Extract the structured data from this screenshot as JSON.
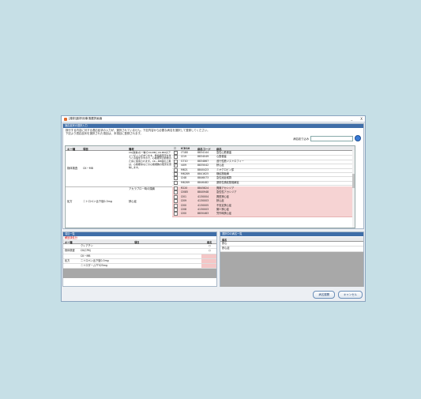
{
  "window": {
    "title": "[薬剤]副作用事項選択画面",
    "minimize": "_",
    "close": "X"
  },
  "top_section": {
    "label": "適応症状の選択入力",
    "message_line1": "検行する内容に対する適応症状の入力が、選択されていません。下記内容から必要な病名を選択して登録してください。",
    "message_line2": "下記より適応症状を選択された項目は、本項目に登録されます。",
    "search_label": "病名絞り込み",
    "search_value": ""
  },
  "grid": {
    "headers": {
      "key": "キー種",
      "item": "項目",
      "note": "備考",
      "check": "☑",
      "icd": "ICD10",
      "code": "病名コード",
      "name": "病名"
    },
    "group1": {
      "key": "検体検査",
      "item": "CK－MB",
      "note": "CK(酵素)の一種でCK-MBとCK-MMのアイソザイムがあります。骨格筋障害を伴うと高値を示すので、心筋障害の診断のために使用されます。CK－MB値の上昇は、心筋梗塞などの心筋細胞の障害を意味します。",
      "rows": [
        {
          "checked": false,
          "icd": "I7180",
          "code": "8834144",
          "name": "急性心筋梗塞",
          "pink": false
        },
        {
          "checked": false,
          "icd": "I219",
          "code": "8834049",
          "name": "心筋梗塞",
          "pink": false
        },
        {
          "checked": false,
          "icd": "G710",
          "code": "8834867",
          "name": "進行性筋ジストロフィー",
          "pink": false
        },
        {
          "checked": true,
          "icd": "I409",
          "code": "8835042",
          "name": "狭心症",
          "pink": false
        },
        {
          "checked": false,
          "icd": "M621",
          "code": "8840423",
          "name": "ミオグロビン尿",
          "pink": false
        },
        {
          "checked": false,
          "icd": "M6289",
          "code": "8841625",
          "name": "横紋筋融解",
          "pink": false
        },
        {
          "checked": false,
          "icd": "I248",
          "code": "8846073",
          "name": "急性冠症候群",
          "pink": false
        },
        {
          "checked": false,
          "icd": "M6289",
          "code": "8846482",
          "name": "薬剤性横紋筋融解症",
          "pink": false
        }
      ]
    },
    "group2": {
      "key": "処方",
      "item": "ニトロペン舌下錠0.3mg",
      "rows": [
        {
          "sub": "アカラブロー時の頭痛",
          "checked": false,
          "icd": "R220",
          "code": "8845824",
          "name": "異痛アカシジア",
          "pink": true
        },
        {
          "sub": "",
          "checked": false,
          "icd": "I2085",
          "code": "8840948",
          "name": "急性性アカシジア",
          "pink": true
        },
        {
          "sub": "",
          "checked": false,
          "icd": "I201",
          "code": "4130004",
          "name": "異型狭心症",
          "pink": true
        },
        {
          "sub": "狭心症",
          "checked": false,
          "icd": "I209",
          "code": "4130003",
          "name": "狭心症",
          "pink": true
        },
        {
          "sub": "",
          "checked": false,
          "icd": "I200",
          "code": "4130005",
          "name": "不安定狭心症",
          "pink": true
        },
        {
          "sub": "",
          "checked": false,
          "icd": "I208",
          "code": "4130003",
          "name": "微少狭心症",
          "pink": true
        },
        {
          "sub": "",
          "checked": false,
          "icd": "I200",
          "code": "8830463",
          "name": "労作時狭心症",
          "pink": true
        }
      ]
    }
  },
  "left_list": {
    "label": "項目一覧",
    "sub": "解放済処分",
    "headers": {
      "key": "キー種",
      "item": "項目",
      "name": "病名"
    },
    "rows": [
      {
        "key": "",
        "item": "クレアチン",
        "mark": "○"
      },
      {
        "key": "検体検査",
        "item": "CK(CPK)",
        "mark": "○"
      },
      {
        "key": "",
        "item": "CK－MB",
        "mark": ""
      },
      {
        "key": "処方",
        "item": "ニトロペン舌下錠0.3mg",
        "mark": ""
      },
      {
        "key": "",
        "item": "ニトロダームTTS25mg",
        "mark": ""
      }
    ]
  },
  "right_list": {
    "label": "選択中の病名一覧",
    "header": "病名",
    "rows": [
      "狭心",
      "狭心症"
    ]
  },
  "buttons": {
    "ok": "病名展開",
    "cancel": "キャンセル"
  }
}
